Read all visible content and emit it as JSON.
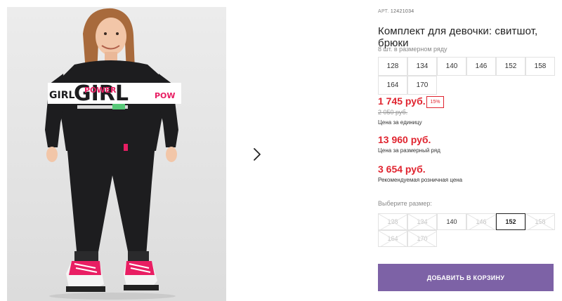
{
  "product": {
    "article_label": "АРТ.",
    "article_number": "12421034",
    "title": "Комплект для девочки: свитшот, брюки",
    "print_text": {
      "line1": "GIRL",
      "line2": "POWER",
      "side_left": "GIRL",
      "side_right": "POW"
    }
  },
  "series": {
    "note": "8 шт. в размерном ряду",
    "sizes": [
      "128",
      "134",
      "140",
      "146",
      "152",
      "158",
      "164",
      "170"
    ]
  },
  "pricing": {
    "main_price": "1 745 руб.",
    "discount": "15%",
    "old_price": "2 050 руб.",
    "unit_label": "Цена за единицу",
    "series_price": "13 960 руб.",
    "series_label": "Цена за размерный ряд",
    "retail_price": "3 654 руб.",
    "retail_label": "Рекомендуемая розничная цена"
  },
  "size_picker": {
    "label": "Выберите размер:",
    "options": [
      {
        "size": "128",
        "available": false
      },
      {
        "size": "134",
        "available": false
      },
      {
        "size": "140",
        "available": true
      },
      {
        "size": "146",
        "available": false
      },
      {
        "size": "152",
        "available": true,
        "selected": true
      },
      {
        "size": "158",
        "available": false
      },
      {
        "size": "164",
        "available": false
      },
      {
        "size": "170",
        "available": false
      }
    ]
  },
  "actions": {
    "add_to_cart": "ДОБАВИТЬ В КОРЗИНУ",
    "next_image_icon": "chevron-right-icon"
  },
  "colors": {
    "accent_price": "#e0242f",
    "cart_button": "#7d62a6",
    "selected_border": "#222222"
  }
}
